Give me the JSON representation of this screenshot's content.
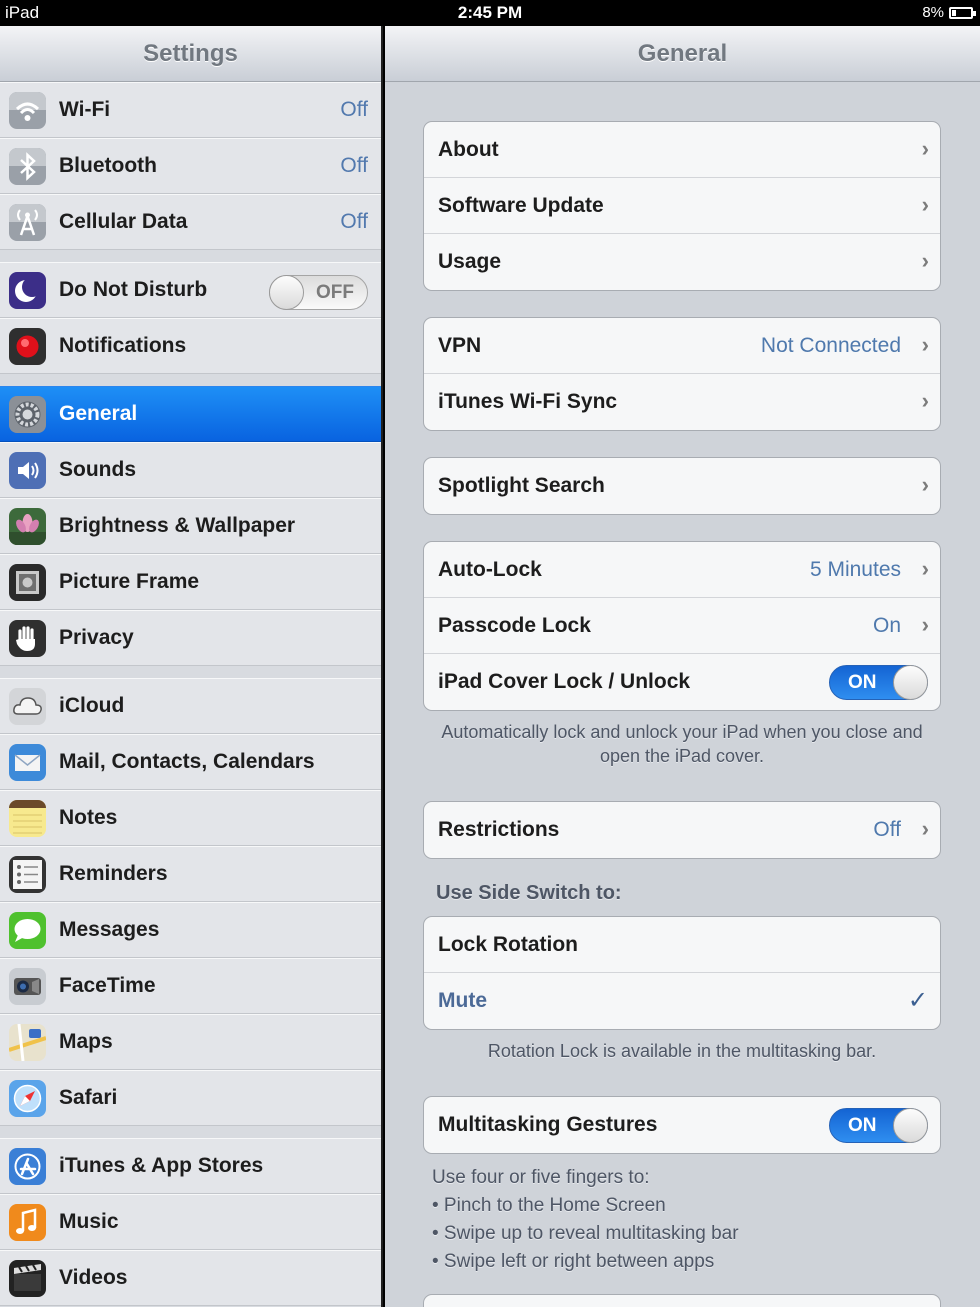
{
  "status_bar": {
    "carrier": "iPad",
    "time": "2:45 PM",
    "battery": "8%"
  },
  "sidebar": {
    "title": "Settings",
    "groups": [
      [
        {
          "label": "Wi-Fi",
          "value": "Off",
          "icon": "wifi-icon"
        },
        {
          "label": "Bluetooth",
          "value": "Off",
          "icon": "bluetooth-icon"
        },
        {
          "label": "Cellular Data",
          "value": "Off",
          "icon": "cellular-icon"
        }
      ],
      [
        {
          "label": "Do Not Disturb",
          "toggle": "OFF",
          "icon": "moon-icon"
        },
        {
          "label": "Notifications",
          "icon": "notifications-icon"
        }
      ],
      [
        {
          "label": "General",
          "icon": "gear-icon",
          "selected": true
        },
        {
          "label": "Sounds",
          "icon": "speaker-icon"
        },
        {
          "label": "Brightness & Wallpaper",
          "icon": "flower-icon"
        },
        {
          "label": "Picture Frame",
          "icon": "picture-frame-icon"
        },
        {
          "label": "Privacy",
          "icon": "hand-icon"
        }
      ],
      [
        {
          "label": "iCloud",
          "icon": "cloud-icon"
        },
        {
          "label": "Mail, Contacts, Calendars",
          "icon": "mail-icon"
        },
        {
          "label": "Notes",
          "icon": "notes-icon"
        },
        {
          "label": "Reminders",
          "icon": "reminders-icon"
        },
        {
          "label": "Messages",
          "icon": "messages-icon"
        },
        {
          "label": "FaceTime",
          "icon": "facetime-icon"
        },
        {
          "label": "Maps",
          "icon": "maps-icon"
        },
        {
          "label": "Safari",
          "icon": "safari-icon"
        }
      ],
      [
        {
          "label": "iTunes & App Stores",
          "icon": "app-store-icon"
        },
        {
          "label": "Music",
          "icon": "music-icon"
        },
        {
          "label": "Videos",
          "icon": "videos-icon"
        }
      ]
    ]
  },
  "main": {
    "title": "General",
    "group1": [
      {
        "label": "About"
      },
      {
        "label": "Software Update"
      },
      {
        "label": "Usage"
      }
    ],
    "group2": [
      {
        "label": "VPN",
        "value": "Not Connected"
      },
      {
        "label": "iTunes Wi-Fi Sync"
      }
    ],
    "group3": [
      {
        "label": "Spotlight Search"
      }
    ],
    "group4": [
      {
        "label": "Auto-Lock",
        "value": "5 Minutes"
      },
      {
        "label": "Passcode Lock",
        "value": "On"
      },
      {
        "label": "iPad Cover Lock / Unlock",
        "toggle": "ON"
      }
    ],
    "cover_note": "Automatically lock and unlock your iPad when you close and open the iPad cover.",
    "restrictions": {
      "label": "Restrictions",
      "value": "Off"
    },
    "side_switch_header": "Use Side Switch to:",
    "side_switch": [
      {
        "label": "Lock Rotation"
      },
      {
        "label": "Mute",
        "checked": true
      }
    ],
    "rotation_note": "Rotation Lock is available in the multitasking bar.",
    "multitasking": {
      "label": "Multitasking Gestures",
      "toggle": "ON"
    },
    "gestures_intro": "Use four or five fingers to:",
    "gestures": [
      "• Pinch to the Home Screen",
      "• Swipe up to reveal multitasking bar",
      "• Swipe left or right between apps"
    ]
  }
}
